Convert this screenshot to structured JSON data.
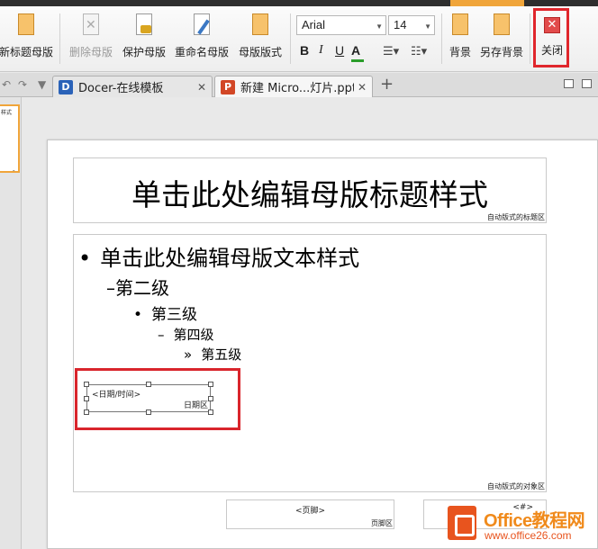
{
  "ribbon": {
    "buttons": [
      {
        "label": "新标题母版",
        "icon": "new-title-master-icon",
        "enabled": true
      },
      {
        "label": "删除母版",
        "icon": "delete-master-icon",
        "enabled": false
      },
      {
        "label": "保护母版",
        "icon": "protect-master-icon",
        "enabled": true
      },
      {
        "label": "重命名母版",
        "icon": "rename-master-icon",
        "enabled": true
      },
      {
        "label": "母版版式",
        "icon": "master-layout-icon",
        "enabled": true
      },
      {
        "label": "背景",
        "icon": "background-icon",
        "enabled": true
      },
      {
        "label": "另存背景",
        "icon": "save-background-icon",
        "enabled": true
      },
      {
        "label": "关闭",
        "icon": "close-icon",
        "enabled": true
      }
    ],
    "font": {
      "name": "Arial",
      "size": "14"
    },
    "format": {
      "bold": "B",
      "italic": "I",
      "underline": "U",
      "color": "A"
    },
    "highlight_color": "#e0262c"
  },
  "tabs": [
    {
      "label": "Docer-在线模板",
      "icon": "docer-icon"
    },
    {
      "label": "新建 Micro...灯片.ppt *",
      "icon": "ppt-icon"
    }
  ],
  "thumbnail": {
    "text": "样式"
  },
  "slide": {
    "title": "单击此处编辑母版标题样式",
    "title_area_label": "自动版式的标题区",
    "levels": [
      {
        "bullet": "•",
        "text": "单击此处编辑母版文本样式"
      },
      {
        "bullet": "–",
        "text": "第二级"
      },
      {
        "bullet": "•",
        "text": "第三级"
      },
      {
        "bullet": "–",
        "text": "第四级"
      },
      {
        "bullet": "»",
        "text": "第五级"
      }
    ],
    "object_area_label": "自动版式的对象区",
    "date_placeholder": "<日期/时间>",
    "date_area_label": "日期区",
    "footer_placeholder": "<页脚>",
    "footer_area_label": "页脚区",
    "number_placeholder": "<#>"
  },
  "watermark": {
    "title": "Office教程网",
    "url": "www.office26.com"
  }
}
